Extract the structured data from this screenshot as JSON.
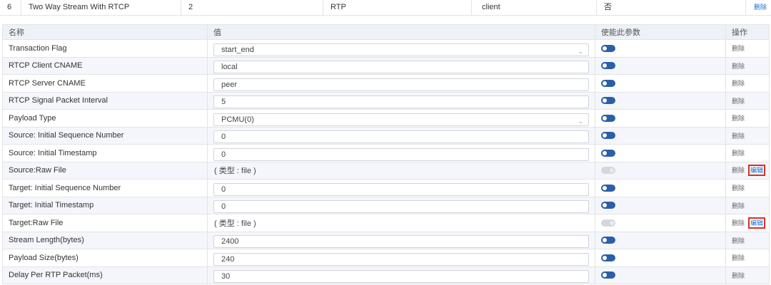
{
  "top_row": {
    "index": "6",
    "name": "Two Way Stream With RTCP",
    "count": "2",
    "protocol": "RTP",
    "role": "client",
    "flag": "否",
    "delete_label": "删除"
  },
  "param_table": {
    "headers": {
      "name": "名称",
      "value": "值",
      "enable": "使能此参数",
      "action": "操作"
    },
    "delete_label": "删除",
    "edit_label": "编辑",
    "rows": [
      {
        "name": "Transaction Flag",
        "value": "start_end",
        "kind": "select",
        "enabled": true
      },
      {
        "name": "RTCP Client CNAME",
        "value": "local",
        "kind": "input",
        "enabled": true
      },
      {
        "name": "RTCP Server CNAME",
        "value": "peer",
        "kind": "input",
        "enabled": true
      },
      {
        "name": "RTCP Signal Packet Interval",
        "value": "5",
        "kind": "input",
        "enabled": true
      },
      {
        "name": "Payload Type",
        "value": "PCMU(0)",
        "kind": "select",
        "enabled": true
      },
      {
        "name": "Source: Initial Sequence Number",
        "value": "0",
        "kind": "input",
        "enabled": true
      },
      {
        "name": "Source: Initial Timestamp",
        "value": "0",
        "kind": "input",
        "enabled": true
      },
      {
        "name": "Source:Raw File",
        "value": "( 类型 : file )",
        "kind": "file",
        "enabled": false
      },
      {
        "name": "Target: Initial Sequence Number",
        "value": "0",
        "kind": "input",
        "enabled": true
      },
      {
        "name": "Target: Initial Timestamp",
        "value": "0",
        "kind": "input",
        "enabled": true
      },
      {
        "name": "Target:Raw File",
        "value": "( 类型 : file )",
        "kind": "file",
        "enabled": false
      },
      {
        "name": "Stream Length(bytes)",
        "value": "2400",
        "kind": "input",
        "enabled": true
      },
      {
        "name": "Payload Size(bytes)",
        "value": "240",
        "kind": "input",
        "enabled": true
      },
      {
        "name": "Delay Per RTP Packet(ms)",
        "value": "30",
        "kind": "input",
        "enabled": true
      }
    ]
  },
  "colors": {
    "toggle_on": "#2c5fa8",
    "toggle_off": "#d4d7dc",
    "link": "#1a6fd1",
    "highlight": "#d93025"
  }
}
